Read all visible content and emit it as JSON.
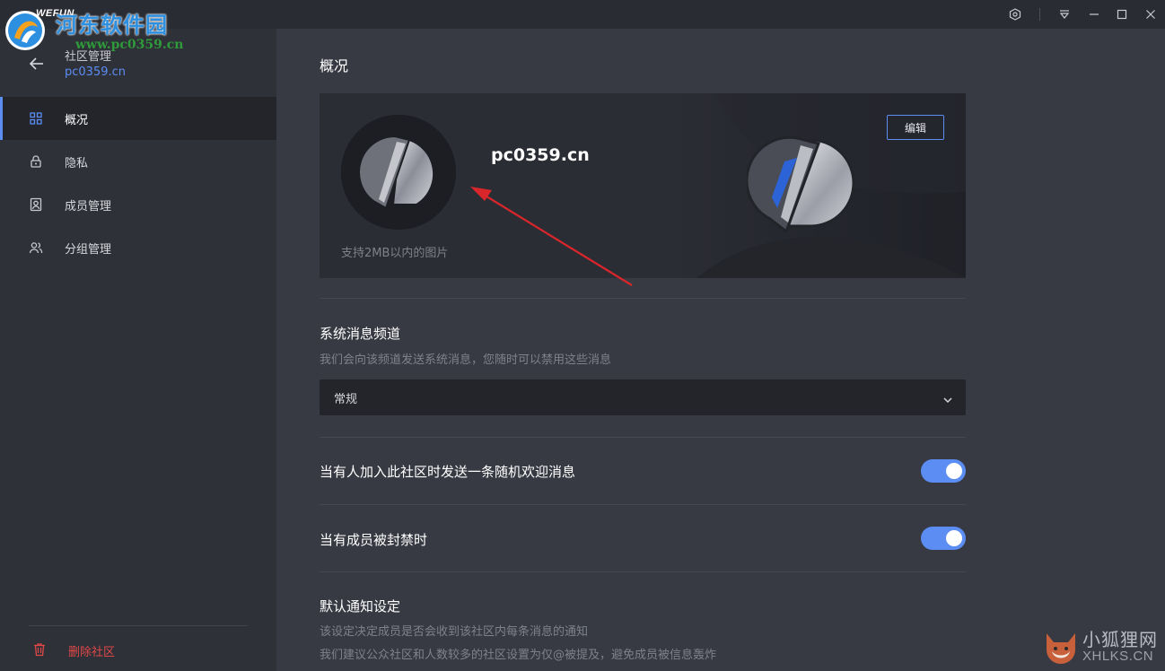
{
  "titlebar": {
    "brand": "WEFUN",
    "watermark_name": "河东软件园",
    "watermark_url": "www.pc0359.cn",
    "icons": [
      "hexagon-icon",
      "menu-dropdown-icon",
      "minimize-icon",
      "maximize-icon",
      "close-icon"
    ]
  },
  "sidebar": {
    "title": "社区管理",
    "subtitle": "pc0359.cn",
    "items": [
      {
        "label": "概况",
        "icon": "grid-icon",
        "active": true
      },
      {
        "label": "隐私",
        "icon": "lock-icon",
        "active": false
      },
      {
        "label": "成员管理",
        "icon": "member-card-icon",
        "active": false
      },
      {
        "label": "分组管理",
        "icon": "group-icon",
        "active": false
      }
    ],
    "delete_label": "删除社区"
  },
  "main": {
    "page_title": "概况",
    "banner": {
      "name": "pc0359.cn",
      "hint": "支持2MB以内的图片",
      "edit_label": "编辑"
    },
    "system_channel": {
      "title": "系统消息频道",
      "desc": "我们会向该频道发送系统消息，您随时可以禁用这些消息",
      "selected": "常规"
    },
    "toggles": [
      {
        "label": "当有人加入此社区时发送一条随机欢迎消息",
        "on": true
      },
      {
        "label": "当有成员被封禁时",
        "on": true
      }
    ],
    "notify": {
      "title": "默认通知设定",
      "desc1": "该设定决定成员是否会收到该社区内每条消息的通知",
      "desc2": "我们建议公众社区和人数较多的社区设置为仅@被提及，避免成员被信息轰炸"
    }
  },
  "watermark2": {
    "cn": "小狐狸网",
    "en": "XHLKS.CN"
  },
  "colors": {
    "accent": "#5b8df2",
    "danger": "#e04848",
    "sidebar_bg": "#2f3138",
    "main_bg": "#383a43"
  }
}
